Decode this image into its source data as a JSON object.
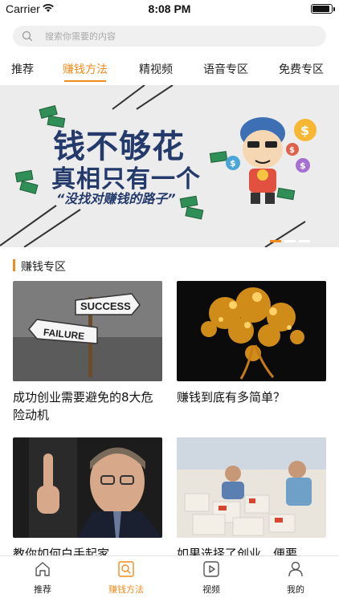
{
  "status_bar": {
    "carrier": "Carrier",
    "time": "8:08 PM"
  },
  "search": {
    "placeholder": "搜索你需要的内容",
    "icon": "search-icon"
  },
  "tabs": [
    {
      "label": "推荐",
      "active": false
    },
    {
      "label": "赚钱方法",
      "active": true
    },
    {
      "label": "精视频",
      "active": false
    },
    {
      "label": "语音专区",
      "active": false
    },
    {
      "label": "免费专区",
      "active": false
    }
  ],
  "banner": {
    "title_line1": "钱不够花",
    "title_line2": "真相只有一个",
    "subtitle": "“没找对赚钱的路子”",
    "pages": 3,
    "current_page": 1
  },
  "section": {
    "title": "赚钱专区"
  },
  "articles": [
    {
      "title": "成功创业需要避免的8大危险动机",
      "thumb_text_1": "SUCCESS",
      "thumb_text_2": "FAILURE"
    },
    {
      "title": "赚钱到底有多简单？"
    },
    {
      "title": "教你如何白手起家"
    },
    {
      "title": "如果选择了创业，便要"
    }
  ],
  "tab_bar": {
    "items": [
      {
        "label": "推荐",
        "icon": "home-icon",
        "active": false
      },
      {
        "label": "赚钱方法",
        "icon": "search-doc-icon",
        "active": true
      },
      {
        "label": "视频",
        "icon": "play-icon",
        "active": false
      },
      {
        "label": "我的",
        "icon": "person-icon",
        "active": false
      }
    ]
  },
  "colors": {
    "accent": "#f28c1c",
    "banner_text": "#243a6b"
  }
}
